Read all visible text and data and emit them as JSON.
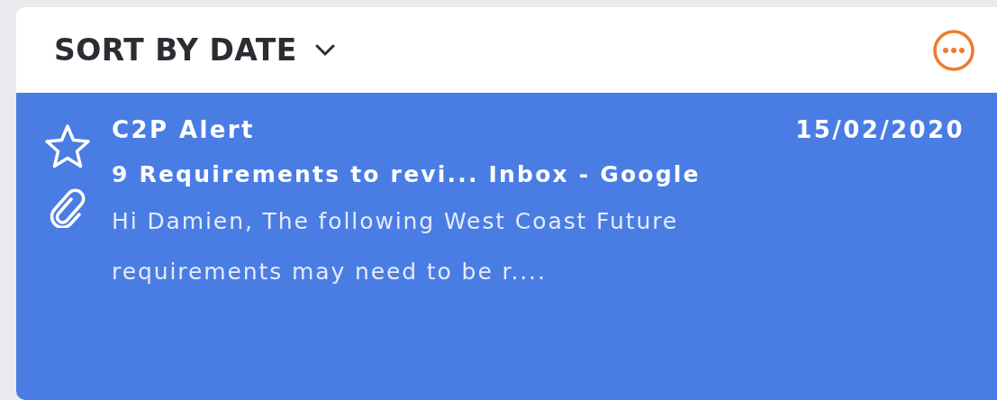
{
  "sort": {
    "label": "SORT BY DATE"
  },
  "messages": [
    {
      "sender": "C2P Alert",
      "date": "15/02/2020",
      "subject": "9 Requirements to revi... Inbox - Google",
      "preview": "Hi Damien, The following West Coast Future requirements may need to be r....",
      "starred": false,
      "has_attachment": true,
      "selected": true
    }
  ]
}
